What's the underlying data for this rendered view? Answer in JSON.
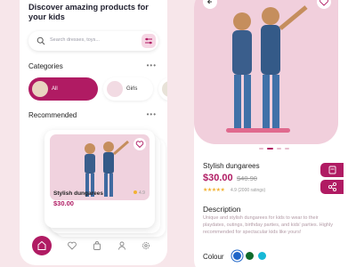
{
  "home": {
    "headline": "Discover amazing products for your kids",
    "search": {
      "placeholder": "Search dresses, toys..."
    },
    "categories": {
      "title": "Categories",
      "more": "•••",
      "items": [
        {
          "label": "All",
          "active": true
        },
        {
          "label": "Girls",
          "active": false
        },
        {
          "label": "Bo",
          "active": false
        }
      ]
    },
    "recommended": {
      "title": "Recommended",
      "more": "•••",
      "product": {
        "name": "Stylish dungarees",
        "price": "$30.00",
        "rating": "4.9"
      }
    },
    "nav": [
      "home-icon",
      "heart-icon",
      "bag-icon",
      "user-icon",
      "settings-icon"
    ]
  },
  "detail": {
    "name": "Stylish dungarees",
    "price": "$30.00",
    "old_price": "$40.90",
    "stars": "★★★★★",
    "rating_text": "4.9 (2000 ratings)",
    "description_title": "Description",
    "description": "Unique and stylish dungarees for kids to wear to their playdates, outings, birthday parties, and kids' parties. Highly recommended for spectacular kids like yours!",
    "colour_label": "Colour",
    "colours": [
      "#1f66c8",
      "#0f6b2a",
      "#17b8d6"
    ]
  },
  "theme": {
    "accent": "#b01b63",
    "background": "#f7e6ea",
    "hero_bg": "#f1cfdc"
  }
}
